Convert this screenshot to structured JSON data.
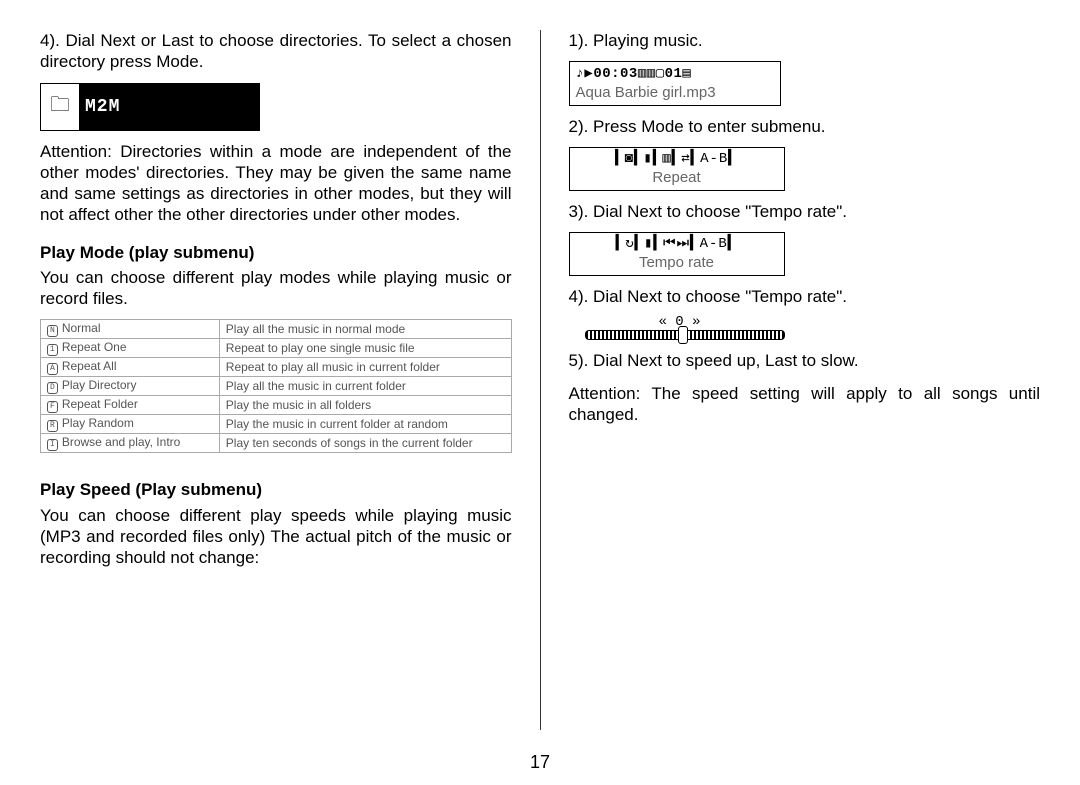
{
  "page_number": "17",
  "left": {
    "step4": "4). Dial Next or Last to choose directories. To select a chosen directory press Mode.",
    "m2m_label": "M2M",
    "attn": "Attention: Directories within a mode are independent of the other modes' directories. They may be given the same name and same settings as directories in other modes, but they will not affect other the other directories under other modes.",
    "play_mode_heading": "Play Mode (play submenu)",
    "play_mode_intro": "You can choose different play modes while playing music or record files.",
    "play_modes": [
      {
        "icon": "N",
        "name": "Normal",
        "desc": "Play all the music in normal mode"
      },
      {
        "icon": "1",
        "name": "Repeat One",
        "desc": "Repeat to play one single music file"
      },
      {
        "icon": "A",
        "name": "Repeat All",
        "desc": "Repeat to play all music in current folder"
      },
      {
        "icon": "D",
        "name": "Play Directory",
        "desc": "Play all the music in current folder"
      },
      {
        "icon": "F",
        "name": "Repeat Folder",
        "desc": "Play the music in all folders"
      },
      {
        "icon": "R",
        "name": "Play Random",
        "desc": "Play the music in current folder at random"
      },
      {
        "icon": "I",
        "name": "Browse and play, Intro",
        "desc": "Play ten seconds of songs in the current folder"
      }
    ],
    "play_speed_heading": "Play Speed (Play submenu)",
    "play_speed_intro": "You can choose different play speeds while playing music (MP3 and recorded files only) The actual pitch of the music or recording should not change:"
  },
  "right": {
    "step1": "1). Playing music.",
    "lcd_play_top": "♪▶00:03▥▥▢01▤",
    "lcd_play_file": "Aqua Barbie girl.mp3",
    "step2": "2). Press Mode to enter submenu.",
    "lcd_repeat_icons": "▍◙▍▮▍▥▍⇄▍A-B▍",
    "lcd_repeat_label": "Repeat",
    "step3": "3). Dial Next to choose \"Tempo rate\".",
    "lcd_tempo_icons": "▍↻▍▮▍⏮⏭▍A-B▍",
    "lcd_tempo_label": "Tempo rate",
    "step4r": "4). Dial Next to choose \"Tempo rate\".",
    "slider_top": "« 0 »",
    "step5": "5). Dial Next to speed up, Last to slow.",
    "attn_r": "Attention: The speed setting will apply to all songs until changed."
  }
}
